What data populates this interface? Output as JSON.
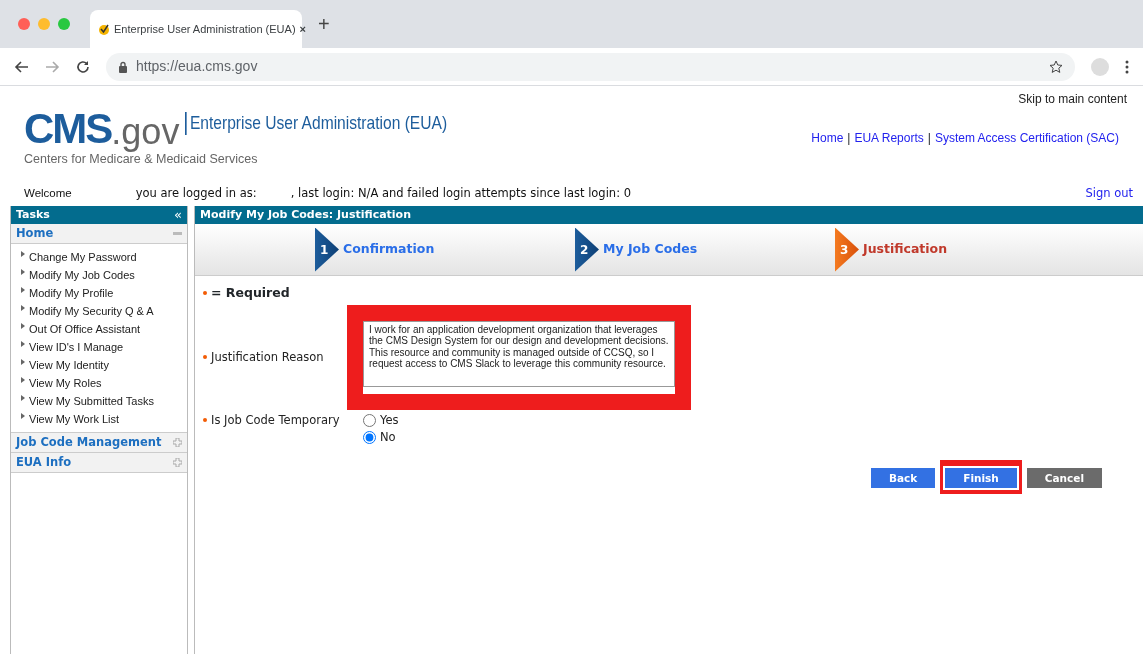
{
  "browser": {
    "tab_title": "Enterprise User Administration (EUA)",
    "tab_close": "×",
    "new_tab": "+",
    "url": "https://eua.cms.gov"
  },
  "header": {
    "skip_link": "Skip to main content",
    "logo": "CMS",
    "logo_suffix": ".gov",
    "logo_subtitle": "Centers for Medicare & Medicaid Services",
    "app_title": "Enterprise User Administration (EUA)",
    "nav": [
      {
        "kind": "link",
        "label": "Home"
      },
      {
        "kind": "separator",
        "label": "|"
      },
      {
        "kind": "link",
        "label": "EUA Reports"
      },
      {
        "kind": "separator",
        "label": "|"
      },
      {
        "kind": "link",
        "label": "System Access Certification (SAC)"
      }
    ]
  },
  "welcome": {
    "greeting": "Welcome",
    "logged_in": "you are logged in as:",
    "last_login": ", last login: N/A and failed login attempts since last login: 0",
    "sign_out": "Sign out"
  },
  "sidebar": {
    "title": "Tasks",
    "collapse": "«",
    "sections": [
      {
        "label": "Home",
        "expanded": true,
        "items": [
          "Change My Password",
          "Modify My Job Codes",
          "Modify My Profile",
          "Modify My Security Q & A",
          "Out Of Office Assistant",
          "View ID's I Manage",
          "View My Identity",
          "View My Roles",
          "View My Submitted Tasks",
          "View My Work List"
        ]
      },
      {
        "label": "Job Code Management",
        "expanded": false
      },
      {
        "label": "EUA Info",
        "expanded": false
      }
    ]
  },
  "main": {
    "title": "Modify My Job Codes: Justification",
    "steps": [
      {
        "number": "1",
        "label": "Confirmation",
        "selected": false
      },
      {
        "number": "2",
        "label": "My Job Codes",
        "selected": false
      },
      {
        "number": "3",
        "label": "Justification",
        "selected": true
      }
    ],
    "required_note": "= Required",
    "justification": {
      "label": "Justification Reason",
      "value": "I work for an application development organization that leverages the CMS Design System for our design and development decisions. This resource and community is managed outside of CCSQ, so I request access to CMS Slack to leverage this community resource.",
      "highlighted": true
    },
    "temporary": {
      "label": "Is Job Code Temporary",
      "options": [
        {
          "label": "Yes",
          "selected": false
        },
        {
          "label": "No",
          "selected": true
        }
      ]
    },
    "buttons": [
      {
        "label": "Back",
        "kind": "primary",
        "highlighted": false
      },
      {
        "label": "Finish",
        "kind": "primary",
        "highlighted": true
      },
      {
        "label": "Cancel",
        "kind": "secondary",
        "highlighted": false
      }
    ]
  }
}
